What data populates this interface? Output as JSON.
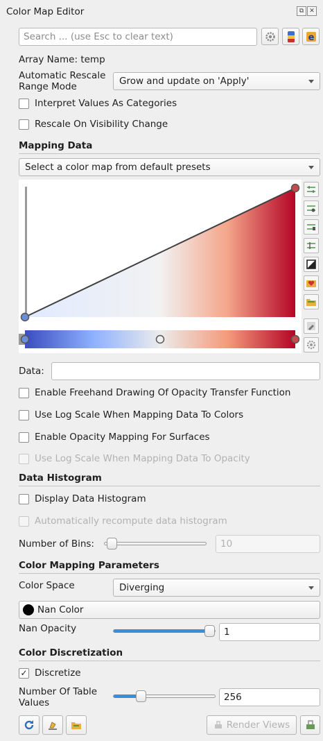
{
  "panel": {
    "title": "Color Map Editor",
    "title_buttons": [
      "⧉",
      "✕"
    ]
  },
  "search": {
    "placeholder": "Search ... (use Esc to clear text)"
  },
  "array_name": "Array Name: temp",
  "rescale": {
    "label": "Automatic Rescale Range Mode",
    "value": "Grow and update on 'Apply'"
  },
  "checks": {
    "categories": {
      "label": "Interpret Values As Categories",
      "checked": false
    },
    "rescale_visibility": {
      "label": "Rescale On Visibility Change",
      "checked": false
    }
  },
  "mapping": {
    "title": "Mapping Data",
    "preset_select": "Select a color map from default presets",
    "data_label": "Data:",
    "data_value": ""
  },
  "transfer_function": {
    "opacity_points": [
      [
        0.0,
        0.0
      ],
      [
        1.0,
        1.0
      ]
    ],
    "color_points": [
      0.0,
      0.5,
      1.0
    ],
    "colors": {
      "low": "#3b4cc0",
      "mid": "#f2f2f2",
      "high": "#b40426"
    }
  },
  "options": {
    "freehand": "Enable Freehand Drawing Of Opacity Transfer Function",
    "log_colors": "Use Log Scale When Mapping Data To Colors",
    "opacity_surfaces": "Enable Opacity Mapping For Surfaces",
    "log_opacity": "Use Log Scale When Mapping Data To Opacity"
  },
  "histogram": {
    "title": "Data Histogram",
    "display": "Display Data Histogram",
    "auto_recompute": "Automatically recompute data histogram",
    "bins_label": "Number of Bins:",
    "bins_value": "10",
    "bins_fraction": 0.0
  },
  "color_params": {
    "title": "Color Mapping Parameters",
    "space_label": "Color Space",
    "space_value": "Diverging",
    "nan_color_label": "Nan Color",
    "nan_color": "#000000",
    "nan_opacity_label": "Nan Opacity",
    "nan_opacity_value": "1",
    "nan_opacity_fraction": 1.0
  },
  "discretization": {
    "title": "Color Discretization",
    "discretize_label": "Discretize",
    "discretize_checked": true,
    "table_values_label": "Number Of Table Values",
    "table_values": "256",
    "table_values_fraction": 0.25
  },
  "footer": {
    "render_views": "Render Views"
  },
  "accent": "#3a8ed8"
}
